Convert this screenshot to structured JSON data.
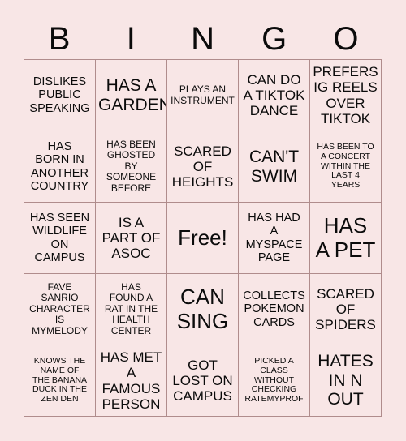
{
  "card": {
    "title_letters": [
      "B",
      "I",
      "N",
      "G",
      "O"
    ],
    "background_color": "#f8e6e6",
    "border_color": "#b08c8c",
    "text_color": "#0b0b0b",
    "grid_size": "5x5",
    "cells": [
      {
        "text": "DISLIKES\nPUBLIC\nSPEAKING",
        "size": "md",
        "free": false
      },
      {
        "text": "HAS A\nGARDEN",
        "size": "xl",
        "free": false
      },
      {
        "text": "PLAYS AN\nINSTRUMENT",
        "size": "sm",
        "free": false
      },
      {
        "text": "CAN DO\nA TIKTOK\nDANCE",
        "size": "lg",
        "free": false
      },
      {
        "text": "PREFERS\nIG REELS\nOVER\nTIKTOK",
        "size": "lg",
        "free": false
      },
      {
        "text": "HAS\nBORN IN\nANOTHER\nCOUNTRY",
        "size": "md",
        "free": false
      },
      {
        "text": "HAS BEEN\nGHOSTED\nBY\nSOMEONE\nBEFORE",
        "size": "sm",
        "free": false
      },
      {
        "text": "SCARED\nOF\nHEIGHTS",
        "size": "lg",
        "free": false
      },
      {
        "text": "CAN'T\nSWIM",
        "size": "xl",
        "free": false
      },
      {
        "text": "HAS BEEN TO\nA CONCERT\nWITHIN THE\nLAST 4\nYEARS",
        "size": "xs",
        "free": false
      },
      {
        "text": "HAS SEEN\nWILDLIFE\nON\nCAMPUS",
        "size": "md",
        "free": false
      },
      {
        "text": "IS A\nPART OF\nASOC",
        "size": "lg",
        "free": false
      },
      {
        "text": "Free!",
        "size": "xxl",
        "free": true
      },
      {
        "text": "HAS HAD\nA\nMYSPACE\nPAGE",
        "size": "md",
        "free": false
      },
      {
        "text": "HAS\nA PET",
        "size": "xxl",
        "free": false
      },
      {
        "text": "FAVE\nSANRIO\nCHARACTER\nIS\nMYMELODY",
        "size": "sm",
        "free": false
      },
      {
        "text": "HAS\nFOUND A\nRAT IN THE\nHEALTH\nCENTER",
        "size": "sm",
        "free": false
      },
      {
        "text": "CAN\nSING",
        "size": "xxl",
        "free": false
      },
      {
        "text": "COLLECTS\nPOKEMON\nCARDS",
        "size": "md",
        "free": false
      },
      {
        "text": "SCARED\nOF\nSPIDERS",
        "size": "lg",
        "free": false
      },
      {
        "text": "KNOWS THE\nNAME OF\nTHE BANANA\nDUCK IN THE\nZEN DEN",
        "size": "xs",
        "free": false
      },
      {
        "text": "HAS MET\nA\nFAMOUS\nPERSON",
        "size": "lg",
        "free": false
      },
      {
        "text": "GOT\nLOST ON\nCAMPUS",
        "size": "lg",
        "free": false
      },
      {
        "text": "PICKED A\nCLASS\nWITHOUT\nCHECKING\nRATEMYPROF",
        "size": "xs",
        "free": false
      },
      {
        "text": "HATES\nIN N\nOUT",
        "size": "xl",
        "free": false
      }
    ]
  }
}
